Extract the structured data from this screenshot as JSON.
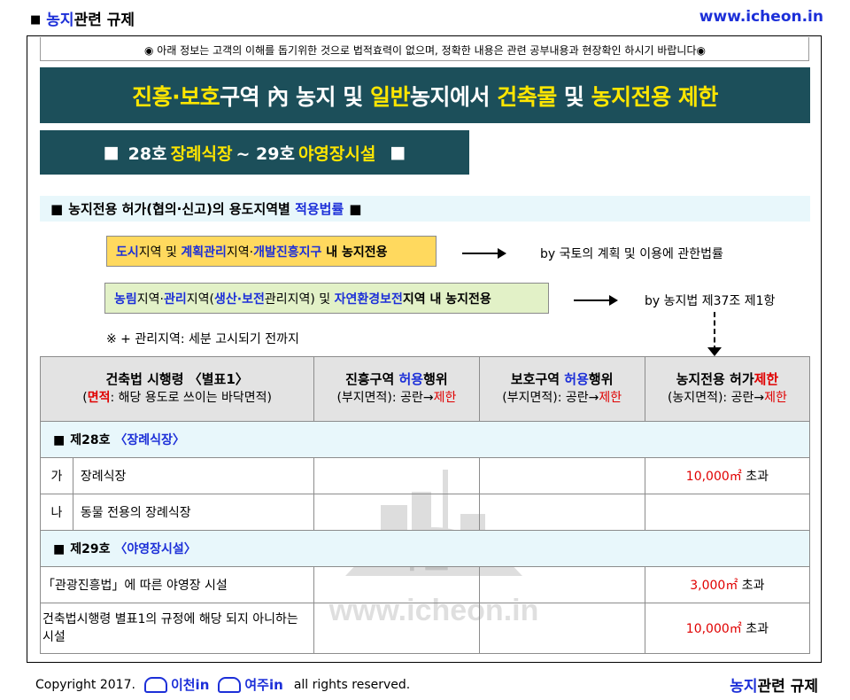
{
  "header": {
    "section_bullet": "■",
    "section_title_blue": "농지",
    "section_title_rest": "관련 규제",
    "site_url": "www.icheon.in"
  },
  "notice": "◉ 아래 정보는 고객의 이해를 돕기위한 것으로 법적효력이 없으며, 정확한 내용은 관련 공부내용과 현장확인 하시기 바랍니다◉",
  "title": {
    "part1_yellow": "진흥·보호",
    "part2": "구역 內 농지 및 ",
    "part3_yellow": "일반",
    "part4": "농지에서 ",
    "part5_yellow": "건축물",
    "part6": " 및 ",
    "part7_yellow": "농지전용 제한"
  },
  "subtitle": {
    "bullet_left": "■",
    "part1": "28호",
    "part2_yellow": "장례식장",
    "part3": "~ 29호",
    "part4_yellow": "야영장시설",
    "bullet_right": "■"
  },
  "applicable_law": {
    "bullet": "■",
    "text": "농지전용 허가(협의·신고)의 용도지역별 ",
    "highlight": "적용법률",
    "bullet_end": "■"
  },
  "zones": [
    {
      "parts": [
        {
          "text": "도시",
          "color": "blue"
        },
        {
          "text": "지역 및 ",
          "color": "black"
        },
        {
          "text": "계획관리",
          "color": "blue"
        },
        {
          "text": "지역·",
          "color": "black"
        },
        {
          "text": "개발진흥지구",
          "color": "blue"
        },
        {
          "text": " 내 농지전용",
          "color": "black"
        }
      ],
      "law": "by 국토의 계획 및 이용에 관한법률"
    },
    {
      "parts": [
        {
          "text": "농림",
          "color": "blue"
        },
        {
          "text": "지역·",
          "color": "black"
        },
        {
          "text": "관리",
          "color": "blue"
        },
        {
          "text": "지역(",
          "color": "black"
        },
        {
          "text": "생산·보전",
          "color": "blue"
        },
        {
          "text": "관리지역) 및 ",
          "color": "black"
        },
        {
          "text": "자연환경보전",
          "color": "blue"
        },
        {
          "text": "지역 내 농지전용",
          "color": "black"
        }
      ],
      "law": "by 농지법 제37조 제1항"
    }
  ],
  "note": "※ + 관리지역: 세분 고시되기 전까지",
  "table": {
    "headers": [
      {
        "line1": "건축법 시행령 〈별표1〉",
        "line2_red": "면적",
        "line2_pre": "(",
        "line2_rest": ": 해당 용도로 쓰이는 바닥면적)"
      },
      {
        "line1_a": "진흥구역 ",
        "line1_blue": "허용",
        "line1_b": "행위",
        "line2_a": "(부지면적): 공란→",
        "line2_red": "제한"
      },
      {
        "line1_a": "보호구역 ",
        "line1_blue": "허용",
        "line1_b": "행위",
        "line2_a": "(부지면적): 공란→",
        "line2_red": "제한"
      },
      {
        "line1_a": "농지전용 허가",
        "line1_red": "제한",
        "line2_a": "(농지면적): 공란→",
        "line2_red": "제한"
      }
    ],
    "sections": [
      {
        "bullet": "■",
        "label": "제28호 ",
        "label_blue": "〈장례식장〉",
        "rows": [
          {
            "idx": "가",
            "name": "장례식장",
            "jinheung": "",
            "boho": "",
            "limit_red": "10,000㎡",
            "limit_rest": " 초과"
          },
          {
            "idx": "나",
            "name": "동물 전용의 장례식장",
            "jinheung": "",
            "boho": "",
            "limit_red": "",
            "limit_rest": ""
          }
        ]
      },
      {
        "bullet": "■",
        "label": "제29호 ",
        "label_blue": "〈야영장시설〉",
        "rows": [
          {
            "idx": "",
            "name": "「관광진흥법」에 따른 야영장 시설",
            "jinheung": "",
            "boho": "",
            "limit_red": "3,000㎡",
            "limit_rest": " 초과"
          },
          {
            "idx": "",
            "name": "건축법시행령 별표1의 규정에 해당 되지 아니하는 시설",
            "jinheung": "",
            "boho": "",
            "limit_red": "10,000㎡",
            "limit_rest": " 초과"
          }
        ]
      }
    ]
  },
  "watermark": {
    "text": "이천in",
    "url": "www.icheon.in"
  },
  "footer": {
    "copyright": "Copyright 2017.",
    "logo1": "이천",
    "logo1_in": "in",
    "logo2": "여주",
    "logo2_in": "in",
    "rights": "all rights reserved.",
    "section_title_blue": "농지",
    "section_title_rest": "관련 규제"
  }
}
